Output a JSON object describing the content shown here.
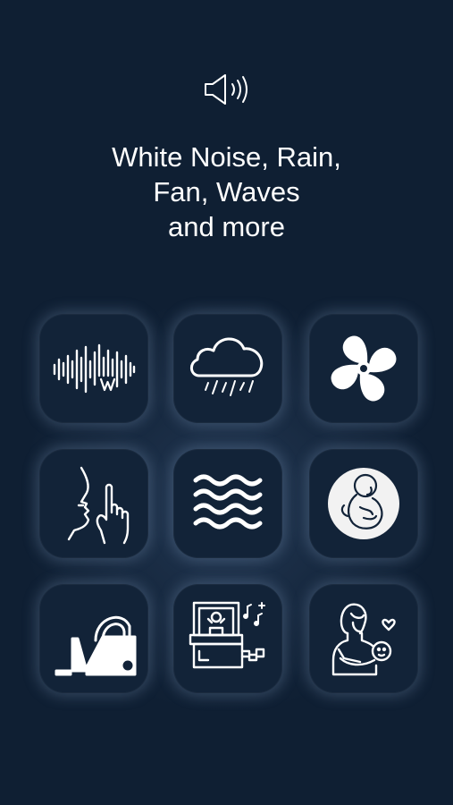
{
  "header": {
    "speaker_icon": "speaker-volume-icon",
    "headline_lines": [
      "White Noise, Rain,",
      "Fan, Waves",
      "and more"
    ]
  },
  "sounds": [
    {
      "icon": "white-noise-waveform-icon"
    },
    {
      "icon": "rain-cloud-icon"
    },
    {
      "icon": "fan-icon"
    },
    {
      "icon": "shush-icon"
    },
    {
      "icon": "waves-icon"
    },
    {
      "icon": "womb-fetus-icon"
    },
    {
      "icon": "vacuum-cleaner-icon"
    },
    {
      "icon": "music-box-icon"
    },
    {
      "icon": "mother-holding-baby-icon"
    }
  ],
  "colors": {
    "background": "#0f1f33",
    "tile": "#122338",
    "icon": "#ffffff",
    "glow": "#96b4d7"
  }
}
